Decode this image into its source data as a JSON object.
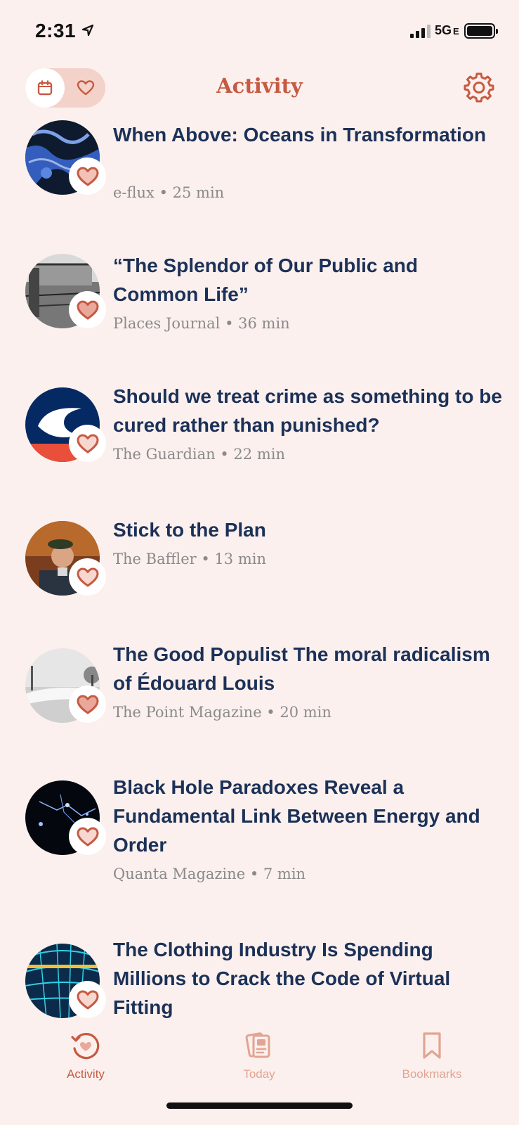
{
  "status_bar": {
    "time": "2:31",
    "network": "5G",
    "network_suffix": "E"
  },
  "header": {
    "title": "Activity",
    "toggle": {
      "active": "calendar-icon",
      "other": "heart-icon"
    },
    "settings_icon": "gear-icon"
  },
  "colors": {
    "accent": "#c65a42",
    "title_text": "#1c3158",
    "meta_text": "#8a8a8a",
    "background": "#fbf0ed",
    "inactive_tab": "#e2a493"
  },
  "feed": {
    "items": [
      {
        "title": "When Above: Oceans in Transformation",
        "meta": "e-flux • 25 min",
        "image": "ocean-satellite-image"
      },
      {
        "title": "“The Splendor of Our Public and Common Life”",
        "meta": "Places Journal • 36 min",
        "image": "historic-photo"
      },
      {
        "title": "Should we treat crime as something to be cured rather than punished?",
        "meta": "The Guardian • 22 min",
        "image": "guardian-logo"
      },
      {
        "title": "Stick to the Plan",
        "meta": "The Baffler • 13 min",
        "image": "portrait-photo"
      },
      {
        "title": "The Good Populist The moral radicalism of Édouard Louis",
        "meta": "The Point Magazine • 20 min",
        "image": "winter-street-photo"
      },
      {
        "title": "Black Hole Paradoxes Reveal a Fundamental Link Between Energy and Order",
        "meta": "Quanta Magazine • 7 min",
        "image": "space-illustration"
      },
      {
        "title": "The Clothing Industry Is Spending Millions to Crack the Code of Virtual Fitting",
        "meta": "",
        "image": "3d-body-scan"
      }
    ]
  },
  "tabbar": {
    "tabs": [
      {
        "label": "Activity",
        "icon": "activity-heart-icon",
        "active": true
      },
      {
        "label": "Today",
        "icon": "cards-icon",
        "active": false
      },
      {
        "label": "Bookmarks",
        "icon": "bookmark-icon",
        "active": false
      }
    ]
  }
}
